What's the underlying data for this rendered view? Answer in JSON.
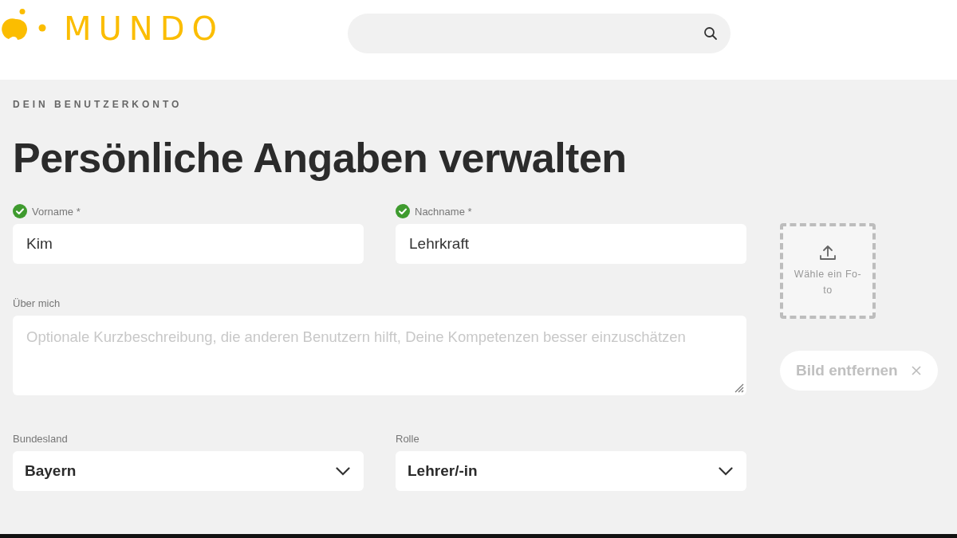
{
  "header": {
    "logo": "MUNDO"
  },
  "page": {
    "eyebrow": "DEIN BENUTZERKONTO",
    "title": "Persönliche Angaben verwalten"
  },
  "fields": [
    {
      "label": "Vorname *",
      "value": "Kim",
      "valid": true
    },
    {
      "label": "Nachname *",
      "value": "Lehrkraft",
      "valid": true
    }
  ],
  "about": {
    "label": "Über mich",
    "placeholder": "Optionale Kurzbeschreibung, die anderen Benutzern hilft, Deine Kompetenzen besser einzuschätzen"
  },
  "selects": [
    {
      "label": "Bundesland",
      "value": "Bayern"
    },
    {
      "label": "Rolle",
      "value": "Lehrer/-in"
    }
  ],
  "photo": {
    "upload_label_lines": [
      "Wähle ein Fo-",
      "to"
    ],
    "remove_label": "Bild entfernen",
    "remove_disabled": true
  }
}
